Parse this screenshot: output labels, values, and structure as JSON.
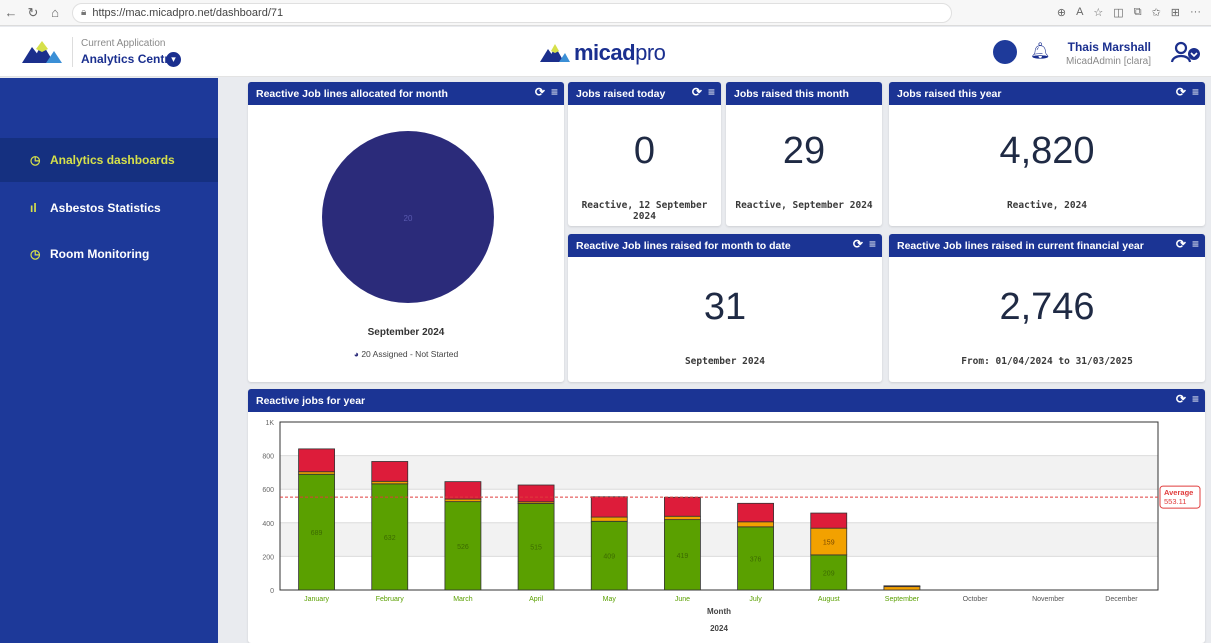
{
  "browser": {
    "url": "https://mac.micadpro.net/dashboard/71"
  },
  "header": {
    "current_application_label": "Current Application",
    "current_application": "Analytics Centre",
    "brand": "micad",
    "brand_suffix": "pro",
    "user_name": "Thais Marshall",
    "user_role": "MicadAdmin [clara]"
  },
  "sidebar": {
    "items": [
      {
        "label": "Analytics dashboards",
        "icon": "clock-icon",
        "active": true
      },
      {
        "label": "Asbestos Statistics",
        "icon": "bar-chart-icon",
        "active": false
      },
      {
        "label": "Room Monitoring",
        "icon": "clock-icon",
        "active": false
      }
    ]
  },
  "widgets": {
    "reactive_allocated": {
      "title": "Reactive Job lines allocated for month",
      "pie_value_label": "20",
      "caption": "September 2024",
      "legend": "20 Assigned - Not Started",
      "pie_color": "#2b2b7a"
    },
    "jobs_today": {
      "title": "Jobs raised today",
      "value": "0",
      "caption": "Reactive, 12 September 2024"
    },
    "jobs_month": {
      "title": "Jobs raised this month",
      "value": "29",
      "caption": "Reactive, September 2024"
    },
    "jobs_year": {
      "title": "Jobs raised this year",
      "value": "4,820",
      "caption": "Reactive, 2024"
    },
    "lines_month_to_date": {
      "title": "Reactive Job lines raised for month to date",
      "value": "31",
      "caption": "September 2024"
    },
    "lines_financial_year": {
      "title": "Reactive Job lines raised in current financial year",
      "value": "2,746",
      "caption": "From: 01/04/2024 to 31/03/2025"
    },
    "reactive_year": {
      "title": "Reactive jobs for year"
    }
  },
  "chart_data": {
    "type": "bar",
    "stacked": true,
    "categories": [
      "January",
      "February",
      "March",
      "April",
      "May",
      "June",
      "July",
      "August",
      "September",
      "October",
      "November",
      "December"
    ],
    "series": [
      {
        "values": [
          689,
          632,
          526,
          515,
          409,
          419,
          376,
          209,
          0,
          0,
          0,
          0
        ],
        "color": "#5aa000",
        "labels": [
          "689",
          "632",
          "526",
          "515",
          "409",
          "419",
          "376",
          "209",
          "",
          "",
          "",
          ""
        ]
      },
      {
        "values": [
          15,
          15,
          15,
          10,
          25,
          20,
          30,
          159,
          20,
          0,
          0,
          0
        ],
        "color": "#f2a100",
        "labels": [
          "",
          "",
          "",
          "",
          "",
          "",
          "",
          "159",
          "",
          "",
          "",
          ""
        ]
      },
      {
        "values": [
          136,
          118,
          104,
          100,
          121,
          113,
          110,
          90,
          5,
          0,
          0,
          0
        ],
        "color": "#dd1c3a",
        "labels": [
          "",
          "",
          "",
          "",
          "",
          "",
          "",
          "",
          "",
          "",
          "",
          ""
        ]
      }
    ],
    "average": 553.11,
    "average_label": "Average",
    "average_value_label": "553.11",
    "ylim": [
      0,
      1000
    ],
    "yticks": [
      0,
      200,
      400,
      600,
      800
    ],
    "ytick_labels": [
      "0",
      "200",
      "400",
      "600",
      "800",
      "1K"
    ],
    "xlabel": "Month",
    "sublabel": "2024",
    "grid": true
  }
}
